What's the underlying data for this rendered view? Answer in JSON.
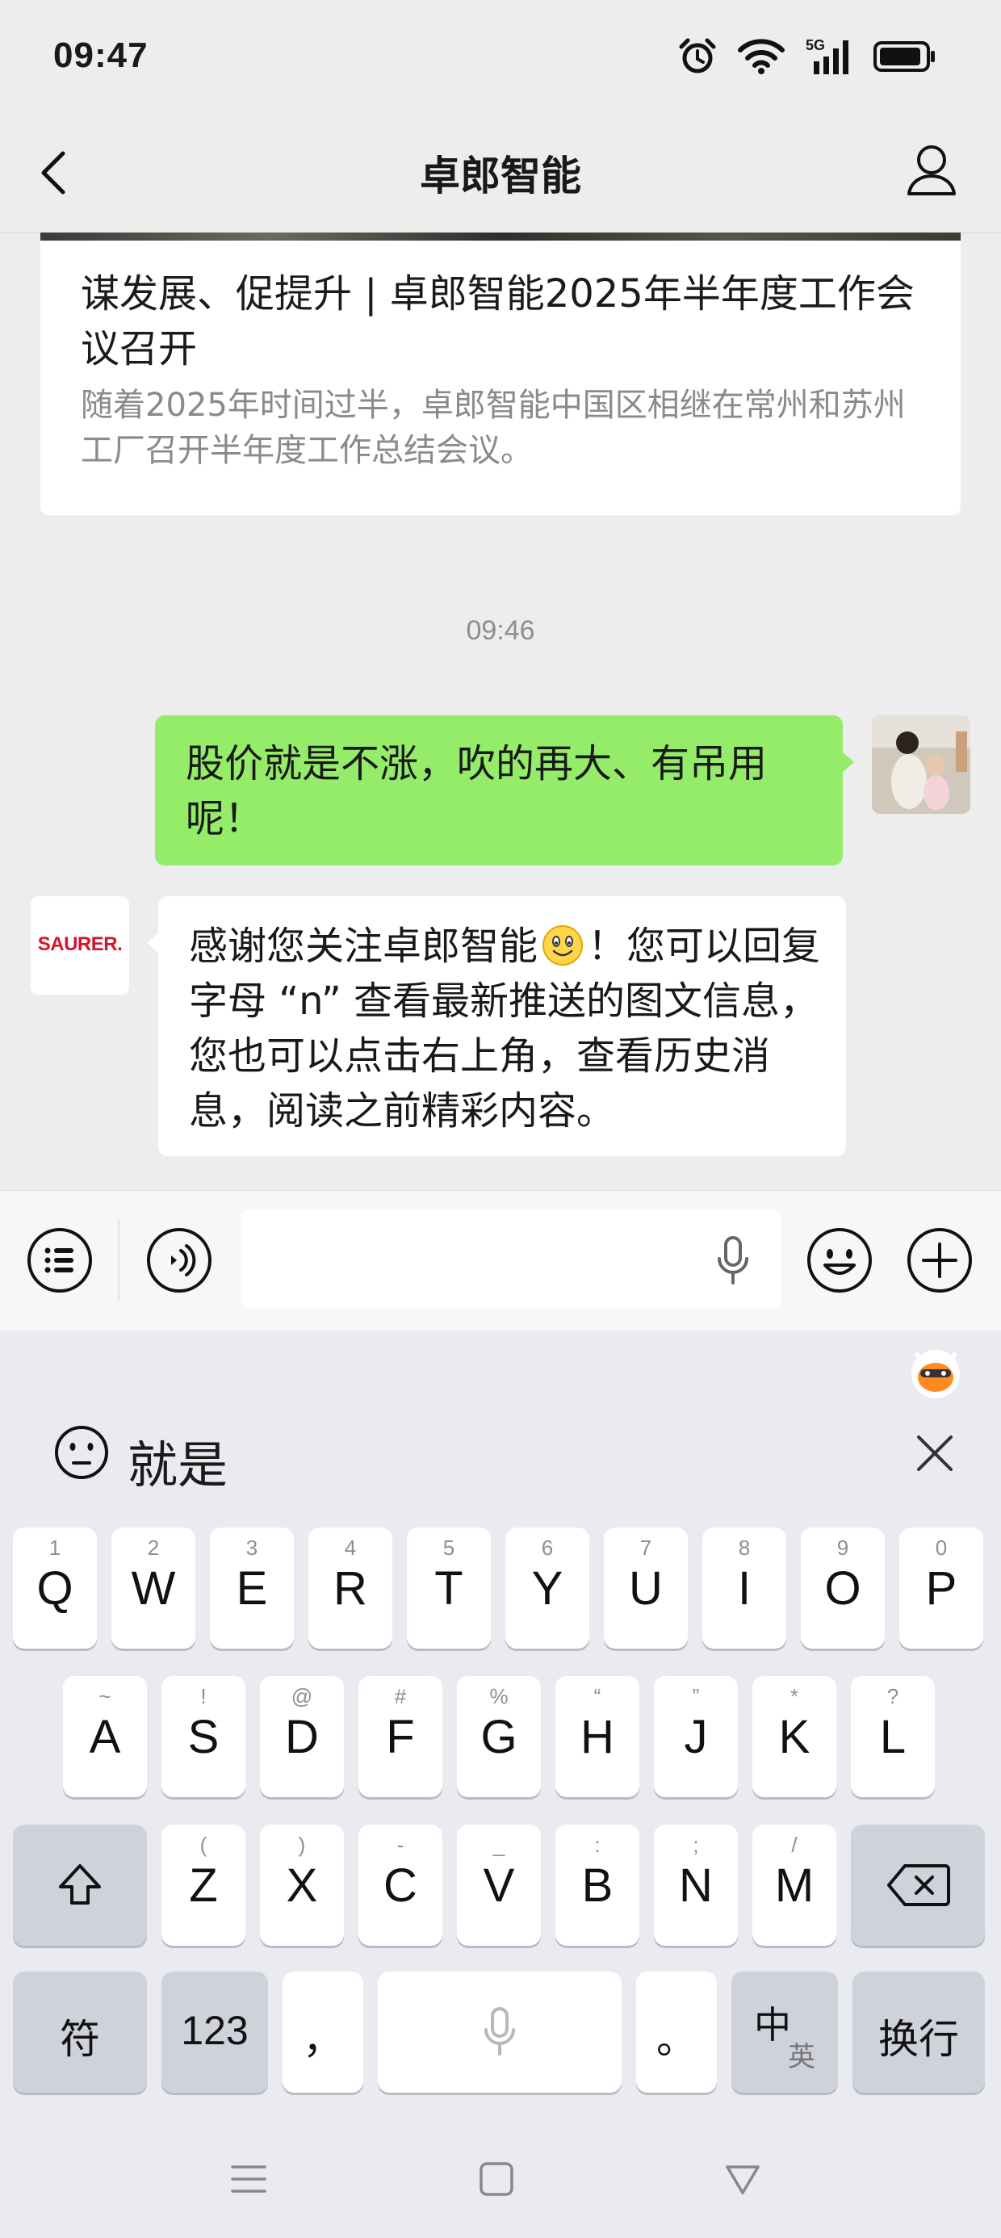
{
  "status_bar": {
    "time": "09:47",
    "network": "5G"
  },
  "header": {
    "title": "卓郎智能"
  },
  "article": {
    "title": "谋发展、促提升 | 卓郎智能2025年半年度工作会议召开",
    "description": "随着2025年时间过半，卓郎智能中国区相继在常州和苏州工厂召开半年度工作总结会议。"
  },
  "timestamp": "09:46",
  "messages": [
    {
      "direction": "outgoing",
      "text": "股价就是不涨，吹的再大、有吊用呢！"
    },
    {
      "direction": "incoming",
      "sender_logo": "SAURER.",
      "text_before_emoji": "感谢您关注卓郎智能",
      "text_after_emoji": "！您可以回复字母 “n” 查看最新推送的图文信息，您也可以点击右上角，查看历史消息，阅读之前精彩内容。"
    }
  ],
  "input": {
    "value": "",
    "placeholder": ""
  },
  "keyboard": {
    "candidate": "就是",
    "row1": [
      {
        "main": "Q",
        "sub": "1"
      },
      {
        "main": "W",
        "sub": "2"
      },
      {
        "main": "E",
        "sub": "3"
      },
      {
        "main": "R",
        "sub": "4"
      },
      {
        "main": "T",
        "sub": "5"
      },
      {
        "main": "Y",
        "sub": "6"
      },
      {
        "main": "U",
        "sub": "7"
      },
      {
        "main": "I",
        "sub": "8"
      },
      {
        "main": "O",
        "sub": "9"
      },
      {
        "main": "P",
        "sub": "0"
      }
    ],
    "row2": [
      {
        "main": "A",
        "sub": "~"
      },
      {
        "main": "S",
        "sub": "!"
      },
      {
        "main": "D",
        "sub": "@"
      },
      {
        "main": "F",
        "sub": "#"
      },
      {
        "main": "G",
        "sub": "%"
      },
      {
        "main": "H",
        "sub": "“"
      },
      {
        "main": "J",
        "sub": "”"
      },
      {
        "main": "K",
        "sub": "*"
      },
      {
        "main": "L",
        "sub": "?"
      }
    ],
    "row3": [
      {
        "main": "Z",
        "sub": "("
      },
      {
        "main": "X",
        "sub": ")"
      },
      {
        "main": "C",
        "sub": "-"
      },
      {
        "main": "V",
        "sub": "_"
      },
      {
        "main": "B",
        "sub": ":"
      },
      {
        "main": "N",
        "sub": ";"
      },
      {
        "main": "M",
        "sub": "/"
      }
    ],
    "symbols_label": "符",
    "numbers_label": "123",
    "comma_label": "，",
    "period_label": "。",
    "lang_main": "中",
    "lang_sub": "英",
    "enter_label": "换行"
  }
}
